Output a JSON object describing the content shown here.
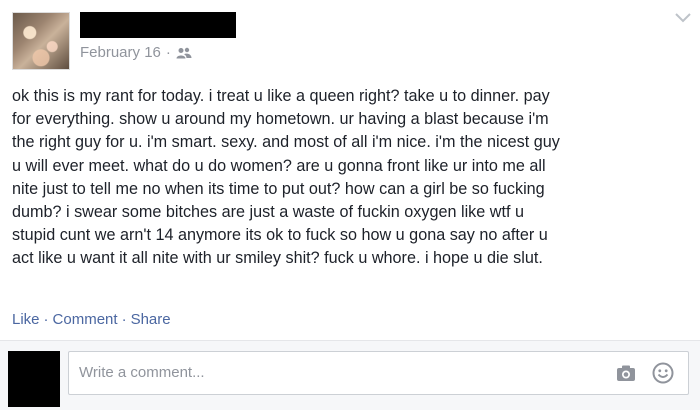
{
  "post": {
    "date": "February 16",
    "separator": "·",
    "audience_icon": "friends-icon",
    "text": "ok this is my rant for today. i treat u like a queen right? take u to dinner. pay\nfor everything. show u around my hometown. ur having a blast because i'm\nthe right guy for u. i'm smart. sexy. and most of all i'm nice. i'm the nicest guy\nu will ever meet. what do u do women? are u gonna front like ur into me all\nnite just to tell me no when its time to put out? how can a girl be so fucking\ndumb? i swear some bitches are just a waste of fuckin oxygen like wtf u\nstupid cunt we arn't 14 anymore its ok to fuck so how u gona say no after u\nact like u want it all nite with ur smiley shit? fuck u whore. i hope u die slut."
  },
  "actions": {
    "like": "Like",
    "comment": "Comment",
    "share": "Share",
    "dot": "·"
  },
  "comment": {
    "placeholder": "Write a comment..."
  },
  "colors": {
    "link": "#4b67a1",
    "meta": "#90949c",
    "text": "#1d2129"
  }
}
